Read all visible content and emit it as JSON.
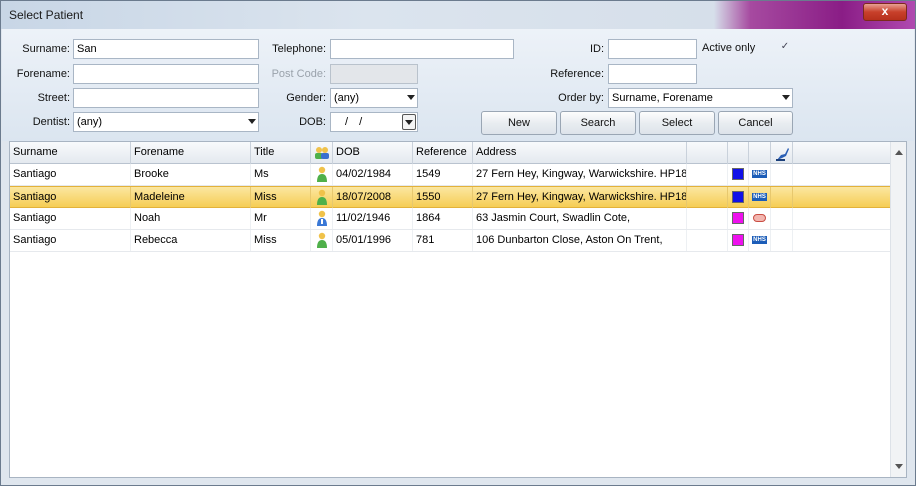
{
  "window": {
    "title": "Select Patient",
    "close_label": "x"
  },
  "form": {
    "surname": {
      "label": "Surname:",
      "value": "San"
    },
    "forename": {
      "label": "Forename:",
      "value": ""
    },
    "street": {
      "label": "Street:",
      "value": ""
    },
    "dentist": {
      "label": "Dentist:",
      "value": "(any)"
    },
    "telephone": {
      "label": "Telephone:",
      "value": ""
    },
    "postcode": {
      "label": "Post Code:",
      "value": ""
    },
    "gender": {
      "label": "Gender:",
      "value": "(any)"
    },
    "dob": {
      "label": "DOB:",
      "value": "/ /"
    },
    "id": {
      "label": "ID:",
      "value": ""
    },
    "reference": {
      "label": "Reference:",
      "value": ""
    },
    "order_by": {
      "label": "Order by:",
      "value": "Surname, Forename"
    },
    "active_only": {
      "label": "Active only",
      "checked": true,
      "check_glyph": "✓"
    }
  },
  "buttons": {
    "new": "New",
    "search": "Search",
    "select": "Select",
    "cancel": "Cancel"
  },
  "grid": {
    "columns": [
      "Surname",
      "Forename",
      "Title",
      "",
      "DOB",
      "Reference",
      "Address",
      "",
      "",
      "",
      ""
    ],
    "rows": [
      {
        "surname": "Santiago",
        "forename": "Brooke",
        "title": "Ms",
        "gender_icon": "female-person-icon",
        "dob": "04/02/1984",
        "reference": "1549",
        "address": "27 Fern Hey, Kingway, Warwickshire. HP18",
        "color": "#1010e8",
        "badge": "nhs-icon",
        "badge_text": "NHS",
        "selected": false
      },
      {
        "surname": "Santiago",
        "forename": "Madeleine",
        "title": "Miss",
        "gender_icon": "female-person-icon",
        "dob": "18/07/2008",
        "reference": "1550",
        "address": "27 Fern Hey, Kingway, Warwickshire. HP18",
        "color": "#1010e8",
        "badge": "nhs-icon",
        "badge_text": "NHS",
        "selected": true
      },
      {
        "surname": "Santiago",
        "forename": "Noah",
        "title": "Mr",
        "gender_icon": "male-person-icon",
        "dob": "11/02/1946",
        "reference": "1864",
        "address": "63 Jasmin Court, Swadlin Cote,",
        "color": "#ee10ee",
        "badge": "mouth-icon",
        "badge_text": "",
        "selected": false
      },
      {
        "surname": "Santiago",
        "forename": "Rebecca",
        "title": "Miss",
        "gender_icon": "female-person-icon",
        "dob": "05/01/1996",
        "reference": "781",
        "address": "106 Dunbarton Close, Aston On Trent,",
        "color": "#ee10ee",
        "badge": "nhs-icon",
        "badge_text": "NHS",
        "selected": false
      }
    ]
  },
  "colors": {
    "selected_row": "#f8d66b",
    "accent_purple": "#8a1d86"
  }
}
